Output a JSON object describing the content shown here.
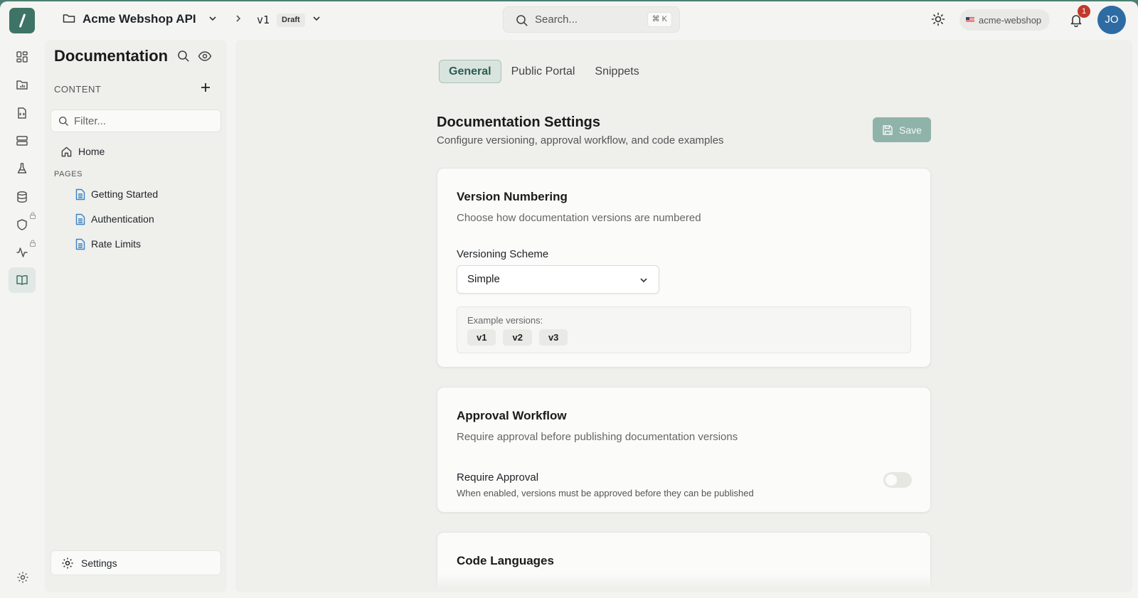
{
  "topbar": {
    "project_name": "Acme Webshop API",
    "version": "v1",
    "version_status": "Draft",
    "search_placeholder": "Search...",
    "search_shortcut": "⌘ K",
    "org_name": "acme-webshop",
    "notification_count": "1",
    "user_initials": "JO"
  },
  "rail": {
    "items": [
      "dashboard-icon",
      "folder-chart-icon",
      "code-file-icon",
      "server-icon",
      "flask-icon",
      "database-icon",
      "shield-icon",
      "activity-icon",
      "book-icon"
    ],
    "locked": [
      "shield-icon",
      "activity-icon"
    ],
    "active": "book-icon"
  },
  "sidebar": {
    "title": "Documentation",
    "content_label": "CONTENT",
    "filter_placeholder": "Filter...",
    "home_label": "Home",
    "pages_label": "PAGES",
    "pages": [
      "Getting Started",
      "Authentication",
      "Rate Limits"
    ],
    "settings_label": "Settings"
  },
  "main": {
    "tabs": [
      {
        "label": "General",
        "active": true
      },
      {
        "label": "Public Portal",
        "active": false
      },
      {
        "label": "Snippets",
        "active": false
      }
    ],
    "title": "Documentation Settings",
    "subtitle": "Configure versioning, approval workflow, and code examples",
    "save_label": "Save",
    "version_card": {
      "title": "Version Numbering",
      "subtitle": "Choose how documentation versions are numbered",
      "field_label": "Versioning Scheme",
      "selected": "Simple",
      "example_label": "Example versions:",
      "examples": [
        "v1",
        "v2",
        "v3"
      ]
    },
    "approval_card": {
      "title": "Approval Workflow",
      "subtitle": "Require approval before publishing documentation versions",
      "toggle_label": "Require Approval",
      "toggle_help": "When enabled, versions must be approved before they can be published",
      "toggle_on": false
    },
    "code_card": {
      "title": "Code Languages"
    }
  },
  "colors": {
    "brand": "#3e7465",
    "accent_tab_bg": "#d9e4df",
    "save_button": "#8fb3a8",
    "notification_badge": "#c0392b",
    "avatar": "#2e6ba3"
  }
}
